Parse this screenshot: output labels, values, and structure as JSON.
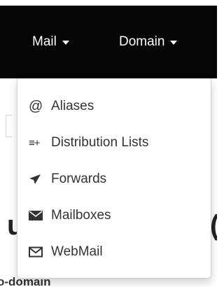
{
  "navbar": {
    "items": [
      {
        "label": "Mail",
        "icon": "caret-down-icon"
      },
      {
        "label": "Domain",
        "icon": "caret-down-icon"
      }
    ]
  },
  "mail_menu": {
    "items": [
      {
        "label": "Aliases",
        "icon": "at-sign-icon",
        "glyph": "@"
      },
      {
        "label": "Distribution Lists",
        "icon": "list-add-icon",
        "glyph": "≡+"
      },
      {
        "label": "Forwards",
        "icon": "paper-plane-icon"
      },
      {
        "label": "Mailboxes",
        "icon": "envelope-filled-icon"
      },
      {
        "label": "WebMail",
        "icon": "envelope-outline-icon"
      }
    ]
  },
  "background": {
    "bottom_text": "o-domain"
  },
  "colors": {
    "navbar_bg": "#050505",
    "menu_text": "#333333",
    "menu_bg": "#ffffff"
  }
}
